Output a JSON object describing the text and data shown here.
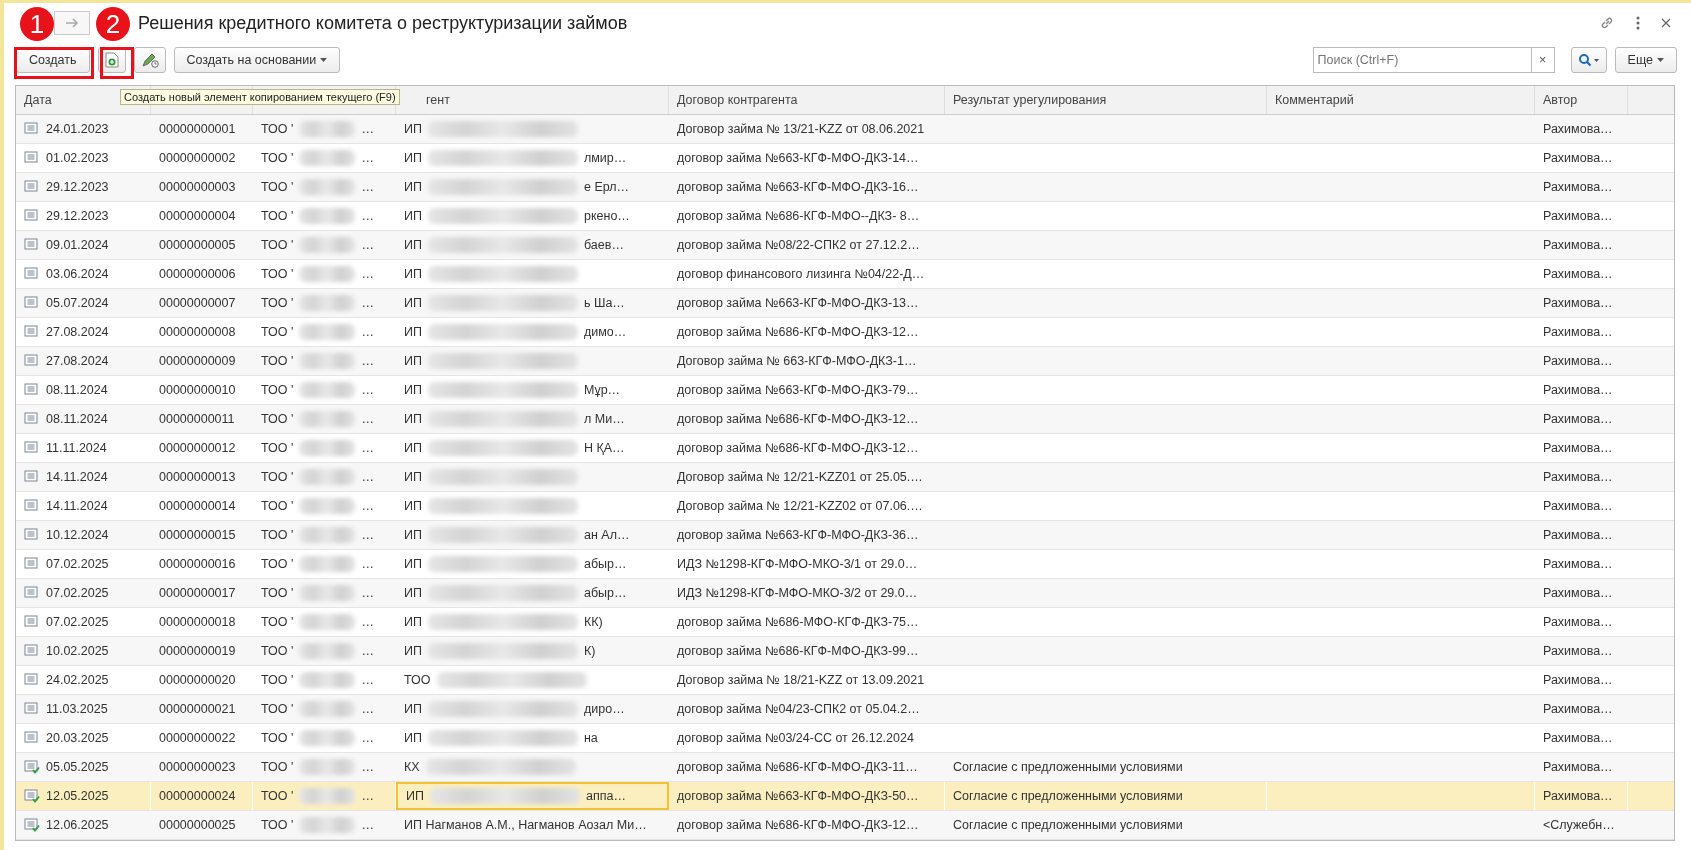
{
  "window": {
    "title": "Решения кредитного комитета о реструктуризации займов"
  },
  "toolbar": {
    "create": "Создать",
    "create_based": "Создать на основании",
    "search_placeholder": "Поиск (Ctrl+F)",
    "clear": "×",
    "more": "Еще"
  },
  "markers": [
    {
      "label": "1"
    },
    {
      "label": "2"
    }
  ],
  "tooltip": "Создать новый элемент копированием текущего (F9)",
  "table": {
    "columns": [
      {
        "label": "Дата"
      },
      {},
      {},
      {
        "label": "гент"
      },
      {
        "label": "Договор контрагента"
      },
      {
        "label": "Результат урегулирования"
      },
      {
        "label": "Комментарий"
      },
      {
        "label": "Автор"
      }
    ],
    "rows": [
      {
        "posted": false,
        "selected": false,
        "date": "24.01.2023",
        "number": "00000000001",
        "org": "ТОО '",
        "org_tail": "…",
        "party": "ИП",
        "contract": "Договор займа № 13/21-KZZ от 08.06.2021",
        "author": "Рахимова…"
      },
      {
        "posted": false,
        "selected": false,
        "date": "01.02.2023",
        "number": "00000000002",
        "org": "ТОО '",
        "org_tail": "…",
        "party": "ИП",
        "party_tail": "лмир…",
        "contract": "договор займа №663-КГФ-МФО-ДКЗ-14…",
        "author": "Рахимова…"
      },
      {
        "posted": false,
        "selected": false,
        "date": "29.12.2023",
        "number": "00000000003",
        "org": "ТОО '",
        "org_tail": "…",
        "party": "ИП",
        "party_tail": "е Ерл…",
        "contract": "договор займа №663-КГФ-МФО-ДКЗ-16…",
        "author": "Рахимова…"
      },
      {
        "posted": false,
        "selected": false,
        "date": "29.12.2023",
        "number": "00000000004",
        "org": "ТОО '",
        "org_tail": "…",
        "party": "ИП",
        "party_tail": "ркено…",
        "contract": "договор займа №686-КГФ-МФО--ДКЗ- 8…",
        "author": "Рахимова…"
      },
      {
        "posted": false,
        "selected": false,
        "date": "09.01.2024",
        "number": "00000000005",
        "org": "ТОО '",
        "org_tail": "…",
        "party": "ИП",
        "party_tail": "баев…",
        "contract": "договор займа №08/22-СПК2 от 27.12.2…",
        "author": "Рахимова…"
      },
      {
        "posted": false,
        "selected": false,
        "date": "03.06.2024",
        "number": "00000000006",
        "org": "ТОО '",
        "org_tail": "…",
        "party": "ИП",
        "contract": "договор финансового лизинга №04/22-Д…",
        "author": "Рахимова…"
      },
      {
        "posted": false,
        "selected": false,
        "date": "05.07.2024",
        "number": "00000000007",
        "org": "ТОО '",
        "org_tail": "…",
        "party": "ИП",
        "party_tail": "ь Ша…",
        "contract": "договор займа №663-КГФ-МФО-ДКЗ-13…",
        "author": "Рахимова…"
      },
      {
        "posted": false,
        "selected": false,
        "date": "27.08.2024",
        "number": "00000000008",
        "org": "ТОО '",
        "org_tail": "…",
        "party": "ИП",
        "party_tail": "димо…",
        "contract": "договор займа №686-КГФ-МФО-ДКЗ-12…",
        "author": "Рахимова…"
      },
      {
        "posted": false,
        "selected": false,
        "date": "27.08.2024",
        "number": "00000000009",
        "org": "ТОО '",
        "org_tail": "…",
        "party": "ИП",
        "contract": "Договор займа № 663-КГФ-МФО-ДКЗ-1…",
        "author": "Рахимова…"
      },
      {
        "posted": false,
        "selected": false,
        "date": "08.11.2024",
        "number": "00000000010",
        "org": "ТОО '",
        "org_tail": "…",
        "party": "ИП",
        "party_tail": "Мұр…",
        "contract": "договор займа №663-КГФ-МФО-ДКЗ-79…",
        "author": "Рахимова…"
      },
      {
        "posted": false,
        "selected": false,
        "date": "08.11.2024",
        "number": "00000000011",
        "org": "ТОО '",
        "org_tail": "…",
        "party": "ИП",
        "party_tail": "л Ми…",
        "contract": "договор займа №686-КГФ-МФО-ДКЗ-12…",
        "author": "Рахимова…"
      },
      {
        "posted": false,
        "selected": false,
        "date": "11.11.2024",
        "number": "00000000012",
        "org": "ТОО '",
        "org_tail": "…",
        "party": "ИП",
        "party_tail": "Н ҚА…",
        "contract": "договор займа №686-КГФ-МФО-ДКЗ-12…",
        "author": "Рахимова…"
      },
      {
        "posted": false,
        "selected": false,
        "date": "14.11.2024",
        "number": "00000000013",
        "org": "ТОО '",
        "org_tail": "…",
        "party": "ИП",
        "contract": "Договор займа № 12/21-KZZ01 от 25.05.…",
        "author": "Рахимова…"
      },
      {
        "posted": false,
        "selected": false,
        "date": "14.11.2024",
        "number": "00000000014",
        "org": "ТОО '",
        "org_tail": "…",
        "party": "ИП",
        "contract": "Договор займа № 12/21-KZZ02 от 07.06.…",
        "author": "Рахимова…"
      },
      {
        "posted": false,
        "selected": false,
        "date": "10.12.2024",
        "number": "00000000015",
        "org": "ТОО '",
        "org_tail": "…",
        "party": "ИП",
        "party_tail": "ан Ал…",
        "contract": "договор займа №663-КГФ-МФО-ДКЗ-36…",
        "author": "Рахимова…"
      },
      {
        "posted": false,
        "selected": false,
        "date": "07.02.2025",
        "number": "00000000016",
        "org": "ТОО '",
        "org_tail": "…",
        "party": "ИП",
        "party_tail": "абыр…",
        "contract": "ИДЗ №1298-КГФ-МФО-МКО-3/1 от 29.0…",
        "author": "Рахимова…"
      },
      {
        "posted": false,
        "selected": false,
        "date": "07.02.2025",
        "number": "00000000017",
        "org": "ТОО '",
        "org_tail": "…",
        "party": "ИП",
        "party_tail": "абыр…",
        "contract": "ИДЗ №1298-КГФ-МФО-МКО-3/2 от 29.0…",
        "author": "Рахимова…"
      },
      {
        "posted": false,
        "selected": false,
        "date": "07.02.2025",
        "number": "00000000018",
        "org": "ТОО '",
        "org_tail": "…",
        "party": "ИП",
        "party_tail": "КК)",
        "contract": "договор займа №686-МФО-КГФ-ДКЗ-75…",
        "author": "Рахимова…"
      },
      {
        "posted": false,
        "selected": false,
        "date": "10.02.2025",
        "number": "00000000019",
        "org": "ТОО '",
        "org_tail": "…",
        "party": "ИП",
        "party_tail": "К)",
        "contract": "договор займа №686-КГФ-МФО-ДКЗ-99…",
        "author": "Рахимова…"
      },
      {
        "posted": false,
        "selected": false,
        "date": "24.02.2025",
        "number": "00000000020",
        "org": "ТОО '",
        "org_tail": "…",
        "party": "ТОО",
        "contract": "Договор займа № 18/21-KZZ от 13.09.2021",
        "author": "Рахимова…"
      },
      {
        "posted": false,
        "selected": false,
        "date": "11.03.2025",
        "number": "00000000021",
        "org": "ТОО '",
        "org_tail": "…",
        "party": "ИП",
        "party_tail": "диро…",
        "contract": "договор займа №04/23-СПК2 от 05.04.2…",
        "author": "Рахимова…"
      },
      {
        "posted": false,
        "selected": false,
        "date": "20.03.2025",
        "number": "00000000022",
        "org": "ТОО '",
        "org_tail": "…",
        "party": "ИП",
        "party_tail": "на",
        "contract": "договор займа №03/24-СС от 26.12.2024",
        "author": "Рахимова…"
      },
      {
        "posted": true,
        "selected": false,
        "date": "05.05.2025",
        "number": "00000000023",
        "org": "ТОО '",
        "org_tail": "…",
        "party": "КХ",
        "contract": "договор займа №686-КГФ-МФО-ДКЗ-11…",
        "result": "Согласие с предложенными условиями",
        "author": "Рахимова…"
      },
      {
        "posted": true,
        "selected": true,
        "date": "12.05.2025",
        "number": "00000000024",
        "org": "ТОО '",
        "org_tail": "…",
        "party": "ИП",
        "party_tail": "аппа…",
        "contract": "договор займа №663-КГФ-МФО-ДКЗ-50…",
        "result": "Согласие с предложенными условиями",
        "author": "Рахимова…"
      },
      {
        "posted": true,
        "selected": false,
        "date": "12.06.2025",
        "number": "00000000025",
        "org": "ТОО '",
        "org_tail": "…",
        "party": "ИП Нагманов А.М., Нагманов Аозал Ми…",
        "party_full": true,
        "contract": "договор займа №686-КГФ-МФО-ДКЗ-12…",
        "result": "Согласие с предложенными условиями",
        "author": "<Служебн…"
      }
    ]
  }
}
